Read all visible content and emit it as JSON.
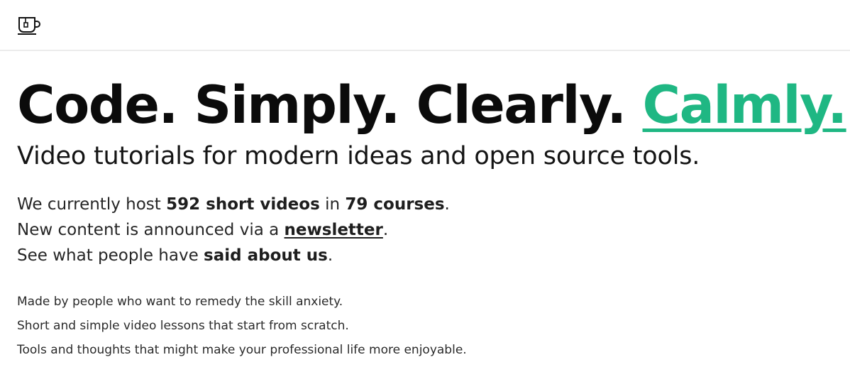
{
  "header": {
    "logo_icon": "coffee-cup-icon"
  },
  "hero": {
    "headline_prefix": "Code. Simply. Clearly.",
    "headline_accent": "Calmly.",
    "accent_color": "#1fb783",
    "subheadline": "Video tutorials for modern ideas and open source tools."
  },
  "stats": {
    "line1_prefix": "We currently host",
    "videos_count": "592 short videos",
    "line1_mid": "in",
    "courses_count": "79 courses",
    "line1_suffix": ".",
    "line2_prefix": "New content is announced via a",
    "newsletter_link": "newsletter",
    "line2_suffix": ".",
    "line3_prefix": "See what people have",
    "said_about_us": "said about us",
    "line3_suffix": "."
  },
  "about": {
    "lines": [
      "Made by people who want to remedy the skill anxiety.",
      "Short and simple video lessons that start from scratch.",
      "Tools and thoughts that might make your professional life more enjoyable."
    ]
  }
}
